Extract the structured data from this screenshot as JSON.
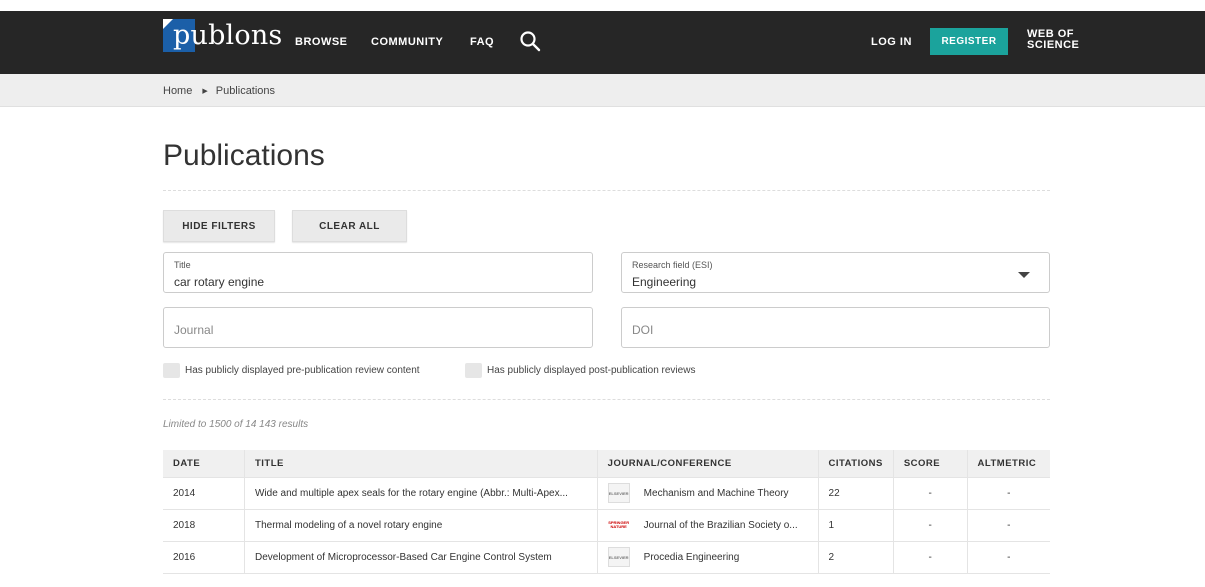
{
  "nav": {
    "logo_text": "publons",
    "links": [
      "BROWSE",
      "COMMUNITY",
      "FAQ"
    ],
    "login": "LOG IN",
    "register": "REGISTER",
    "wos_line1": "WEB OF",
    "wos_line2": "SCIENCE",
    "colors": {
      "bar": "#262626",
      "register": "#1ba39c",
      "logo_mark": "#1b5fa8"
    }
  },
  "breadcrumb": [
    "Home",
    "Publications"
  ],
  "page_title": "Publications",
  "buttons": {
    "hide_filters": "HIDE FILTERS",
    "clear_all": "CLEAR ALL"
  },
  "filters": {
    "title": {
      "label": "Title",
      "value": "car rotary engine"
    },
    "research_field": {
      "label": "Research field (ESI)",
      "value": "Engineering"
    },
    "journal": {
      "placeholder": "Journal"
    },
    "doi": {
      "placeholder": "DOI"
    },
    "check_pre": "Has publicly displayed pre-publication review content",
    "check_post": "Has publicly displayed post-publication reviews"
  },
  "results_note": "Limited to 1500 of 14 143 results",
  "table": {
    "headers": [
      "DATE",
      "TITLE",
      "JOURNAL/CONFERENCE",
      "CITATIONS",
      "SCORE",
      "ALTMETRIC"
    ],
    "rows": [
      {
        "date": "2014",
        "title": "Wide and multiple apex seals for the rotary engine (Abbr.: Multi-Apex...",
        "publisher": "elsevier",
        "journal": "Mechanism and Machine Theory",
        "citations": "22",
        "score": "-",
        "altmetric": "-"
      },
      {
        "date": "2018",
        "title": "Thermal modeling of a novel rotary engine",
        "publisher": "springer",
        "journal": "Journal of the Brazilian Society o...",
        "citations": "1",
        "score": "-",
        "altmetric": "-"
      },
      {
        "date": "2016",
        "title": "Development of Microprocessor-Based Car Engine Control System",
        "publisher": "elsevier",
        "journal": "Procedia Engineering",
        "citations": "2",
        "score": "-",
        "altmetric": "-"
      }
    ]
  }
}
